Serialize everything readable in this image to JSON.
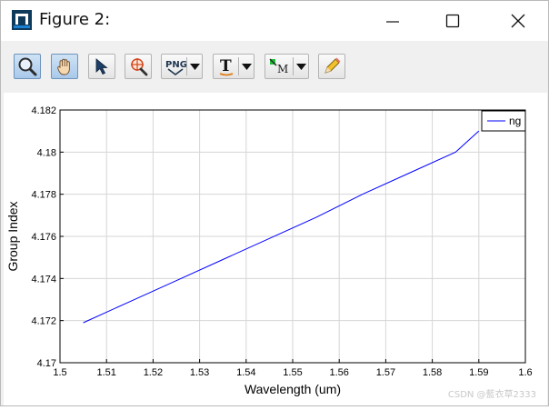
{
  "window": {
    "title": "Figure 2:",
    "controls": [
      "minimize",
      "maximize",
      "close"
    ]
  },
  "toolbar": {
    "buttons": [
      {
        "name": "zoom",
        "icon": "magnifier-icon",
        "active": true
      },
      {
        "name": "pan",
        "icon": "hand-icon",
        "active": true
      },
      {
        "name": "select",
        "icon": "arrow-cursor-icon",
        "active": false
      },
      {
        "name": "data-cursor",
        "icon": "crosshair-magnifier-icon",
        "active": false
      },
      {
        "name": "export",
        "icon": "png-icon",
        "label": "PNG",
        "dropdown": true
      },
      {
        "name": "text",
        "icon": "text-icon",
        "label": "T",
        "dropdown": true
      },
      {
        "name": "marker",
        "icon": "marker-icon",
        "label": "M",
        "dropdown": true
      },
      {
        "name": "edit",
        "icon": "pencil-icon",
        "active": false
      }
    ]
  },
  "chart_data": {
    "type": "line",
    "xlabel": "Wavelength (um)",
    "ylabel": "Group Index",
    "xlim": [
      1.5,
      1.6
    ],
    "ylim": [
      4.17,
      4.182
    ],
    "xticks": [
      "1.5",
      "1.51",
      "1.52",
      "1.53",
      "1.54",
      "1.55",
      "1.56",
      "1.57",
      "1.58",
      "1.59",
      "1.6"
    ],
    "yticks": [
      "4.17",
      "4.172",
      "4.174",
      "4.176",
      "4.178",
      "4.18",
      "4.182"
    ],
    "grid": true,
    "legend": {
      "position": "top-right",
      "entries": [
        "ng"
      ]
    },
    "series": [
      {
        "name": "ng",
        "color": "#0000ff",
        "x": [
          1.505,
          1.515,
          1.525,
          1.535,
          1.545,
          1.555,
          1.565,
          1.575,
          1.585,
          1.59
        ],
        "y": [
          4.1719,
          4.1729,
          4.1739,
          4.1749,
          4.1759,
          4.1769,
          4.178,
          4.179,
          4.18,
          4.181
        ]
      }
    ]
  },
  "watermark": "CSDN @藍衣草2333"
}
